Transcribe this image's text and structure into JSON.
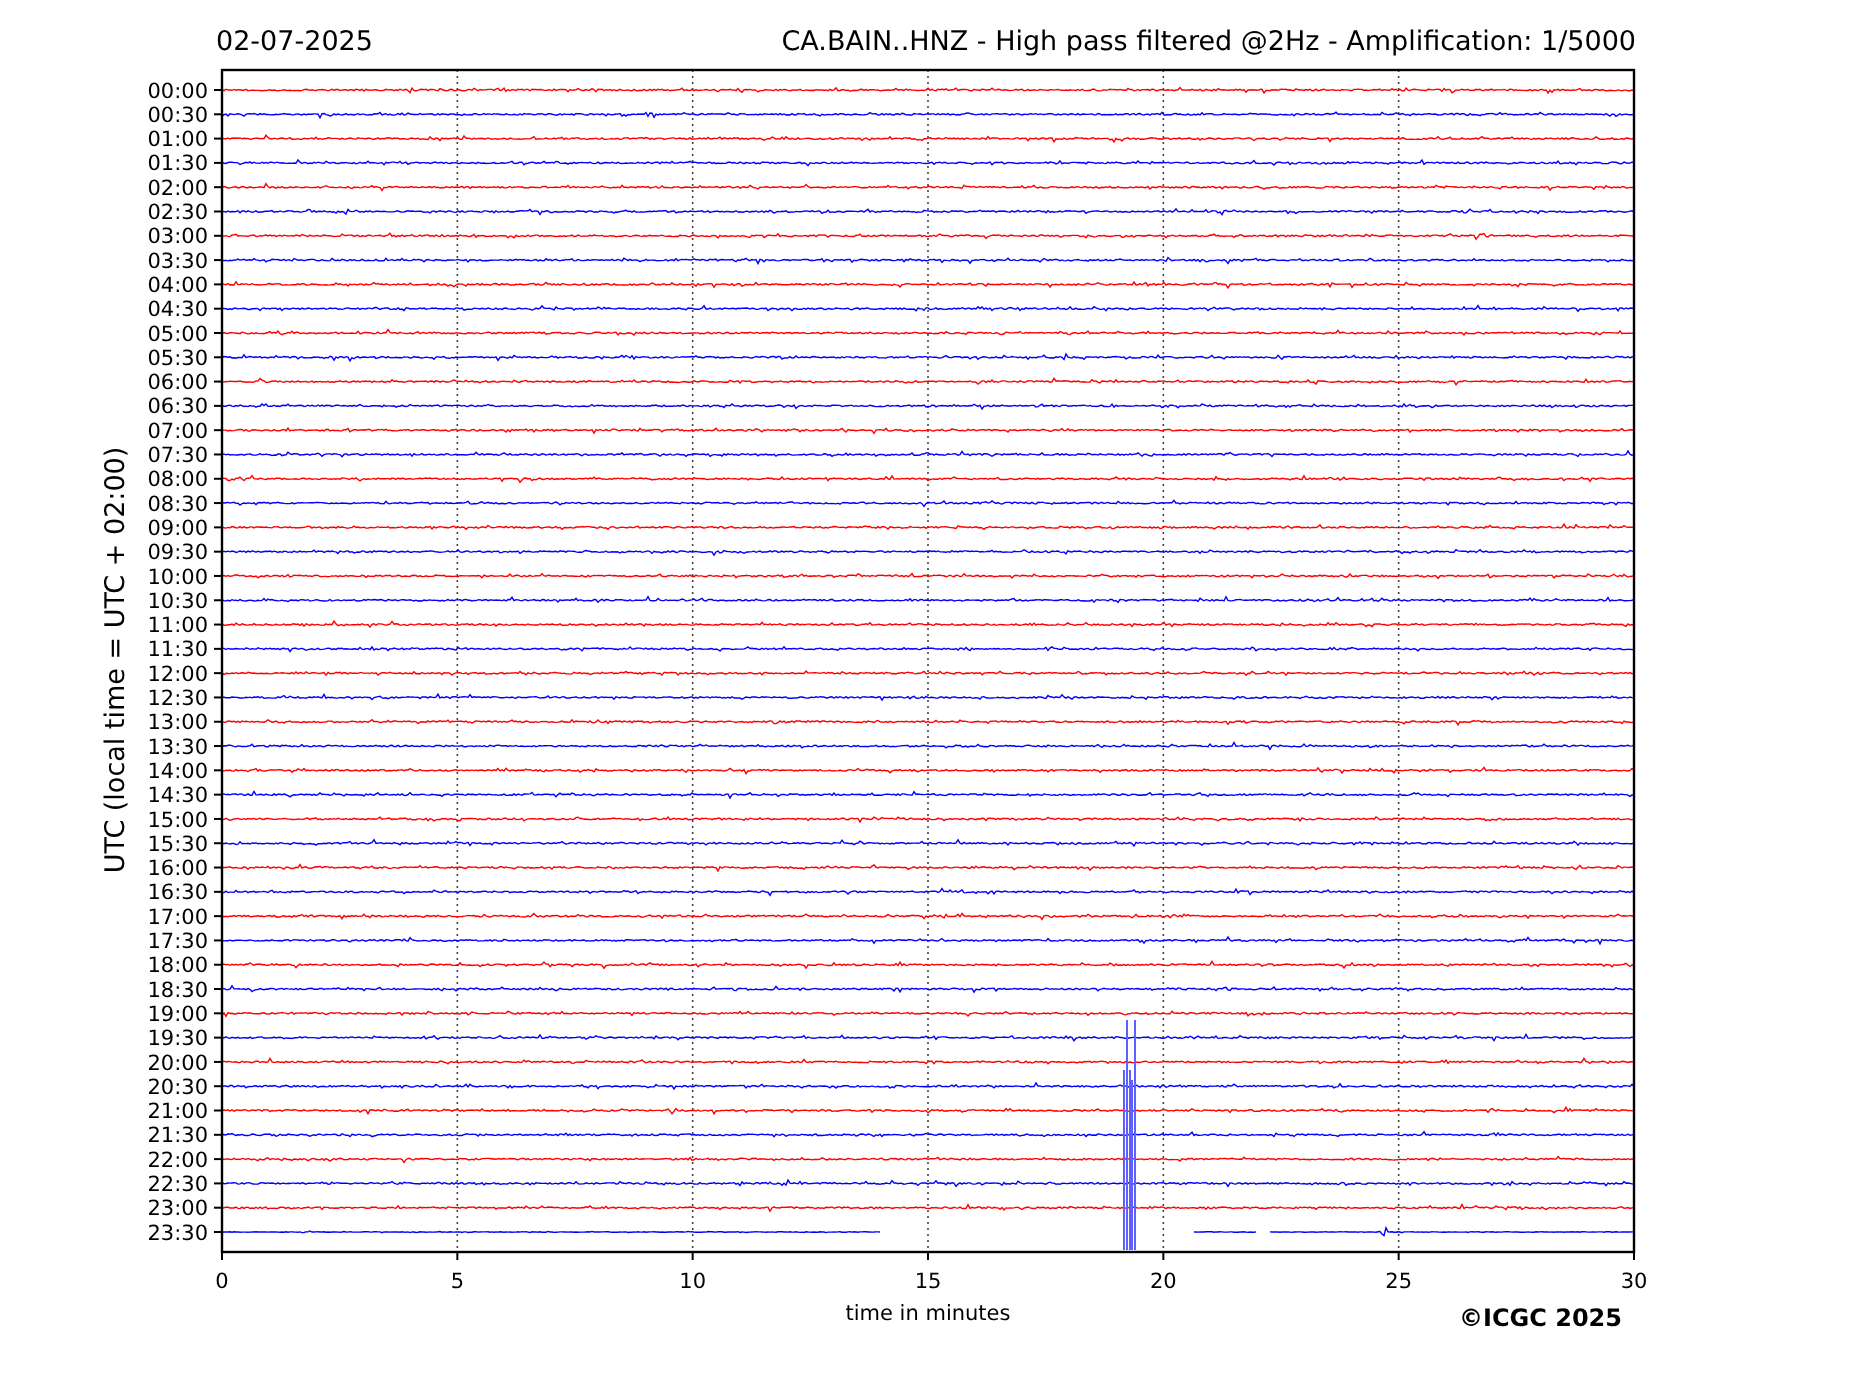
{
  "header": {
    "date": "02-07-2025",
    "title": "CA.BAIN..HNZ - High pass filtered @2Hz - Amplification: 1/5000"
  },
  "plot": {
    "ylabel": "UTC (local time = UTC + 02:00)",
    "xlabel": "time in minutes",
    "xticks": [
      "0",
      "5",
      "10",
      "15",
      "20",
      "25",
      "30"
    ],
    "rows": [
      {
        "label": "00:00",
        "color": "#ff0000"
      },
      {
        "label": "00:30",
        "color": "#0000ff"
      },
      {
        "label": "01:00",
        "color": "#ff0000"
      },
      {
        "label": "01:30",
        "color": "#0000ff"
      },
      {
        "label": "02:00",
        "color": "#ff0000"
      },
      {
        "label": "02:30",
        "color": "#0000ff"
      },
      {
        "label": "03:00",
        "color": "#ff0000"
      },
      {
        "label": "03:30",
        "color": "#0000ff"
      },
      {
        "label": "04:00",
        "color": "#ff0000"
      },
      {
        "label": "04:30",
        "color": "#0000ff"
      },
      {
        "label": "05:00",
        "color": "#ff0000"
      },
      {
        "label": "05:30",
        "color": "#0000ff"
      },
      {
        "label": "06:00",
        "color": "#ff0000"
      },
      {
        "label": "06:30",
        "color": "#0000ff"
      },
      {
        "label": "07:00",
        "color": "#ff0000"
      },
      {
        "label": "07:30",
        "color": "#0000ff"
      },
      {
        "label": "08:00",
        "color": "#ff0000"
      },
      {
        "label": "08:30",
        "color": "#0000ff"
      },
      {
        "label": "09:00",
        "color": "#ff0000"
      },
      {
        "label": "09:30",
        "color": "#0000ff"
      },
      {
        "label": "10:00",
        "color": "#ff0000"
      },
      {
        "label": "10:30",
        "color": "#0000ff"
      },
      {
        "label": "11:00",
        "color": "#ff0000"
      },
      {
        "label": "11:30",
        "color": "#0000ff"
      },
      {
        "label": "12:00",
        "color": "#ff0000"
      },
      {
        "label": "12:30",
        "color": "#0000ff"
      },
      {
        "label": "13:00",
        "color": "#ff0000"
      },
      {
        "label": "13:30",
        "color": "#0000ff"
      },
      {
        "label": "14:00",
        "color": "#ff0000"
      },
      {
        "label": "14:30",
        "color": "#0000ff"
      },
      {
        "label": "15:00",
        "color": "#ff0000"
      },
      {
        "label": "15:30",
        "color": "#0000ff"
      },
      {
        "label": "16:00",
        "color": "#ff0000"
      },
      {
        "label": "16:30",
        "color": "#0000ff"
      },
      {
        "label": "17:00",
        "color": "#ff0000"
      },
      {
        "label": "17:30",
        "color": "#0000ff"
      },
      {
        "label": "18:00",
        "color": "#ff0000"
      },
      {
        "label": "18:30",
        "color": "#0000ff"
      },
      {
        "label": "19:00",
        "color": "#ff0000"
      },
      {
        "label": "19:30",
        "color": "#0000ff"
      },
      {
        "label": "20:00",
        "color": "#ff0000"
      },
      {
        "label": "20:30",
        "color": "#0000ff"
      },
      {
        "label": "21:00",
        "color": "#ff0000"
      },
      {
        "label": "21:30",
        "color": "#0000ff"
      },
      {
        "label": "22:00",
        "color": "#ff0000"
      },
      {
        "label": "22:30",
        "color": "#0000ff"
      },
      {
        "label": "23:00",
        "color": "#ff0000"
      },
      {
        "label": "23:30",
        "color": "#0000ff"
      }
    ]
  },
  "footer": {
    "copyright": "©ICGC 2025"
  }
}
